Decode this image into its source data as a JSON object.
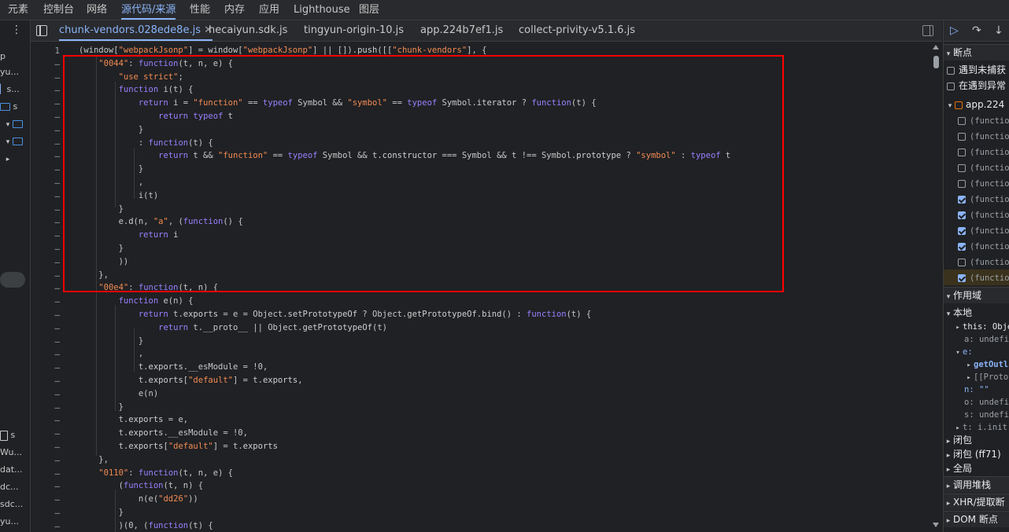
{
  "menu": [
    "元素",
    "控制台",
    "网络",
    "源代码/来源",
    "性能",
    "内存",
    "应用",
    "Lighthouse",
    "图层"
  ],
  "left_sidebar": {
    "rows": [
      "p",
      "yu...",
      "s...",
      "s",
      "",
      "",
      "",
      "s",
      "Wu...",
      "dat...",
      "dc...",
      "sdc...",
      "yu..."
    ]
  },
  "tabs": [
    "chunk-vendors.028ede8e.js",
    "hecaiyun.sdk.js",
    "tingyun-origin-10.js",
    "app.224b7ef1.js",
    "collect-privity-v5.1.6.js"
  ],
  "gutter": {
    "first": "1",
    "marker": "–"
  },
  "code": [
    "(window[\"webpackJsonp\"] = window[\"webpackJsonp\"] || []).push([[\"chunk-vendors\"], {",
    "    \"0044\": function(t, n, e) {",
    "        \"use strict\";",
    "        function i(t) {",
    "            return i = \"function\" == typeof Symbol && \"symbol\" == typeof Symbol.iterator ? function(t) {",
    "                return typeof t",
    "            }",
    "            : function(t) {",
    "                return t && \"function\" == typeof Symbol && t.constructor === Symbol && t !== Symbol.prototype ? \"symbol\" : typeof t",
    "            }",
    "            ,",
    "            i(t)",
    "        }",
    "        e.d(n, \"a\", (function() {",
    "            return i",
    "        }",
    "        ))",
    "    },",
    "    \"00e4\": function(t, n) {",
    "        function e(n) {",
    "            return t.exports = e = Object.setPrototypeOf ? Object.getPrototypeOf.bind() : function(t) {",
    "                return t.__proto__ || Object.getPrototypeOf(t)",
    "            }",
    "            ,",
    "            t.exports.__esModule = !0,",
    "            t.exports[\"default\"] = t.exports,",
    "            e(n)",
    "        }",
    "        t.exports = e,",
    "        t.exports.__esModule = !0,",
    "        t.exports[\"default\"] = t.exports",
    "    },",
    "    \"0110\": function(t, n, e) {",
    "        (function(t, n) {",
    "            n(e(\"dd26\"))",
    "        }",
    "        )(0, (function(t) {"
  ],
  "right_panel": {
    "breakpoints_header": "断点",
    "pause_uncaught": "遇到未捕获",
    "pause_caught": "在遇到异常",
    "file": "app.224",
    "fn_label": "(functio",
    "fn_checked": [
      false,
      false,
      false,
      false,
      false,
      true,
      true,
      true,
      true,
      false,
      true
    ],
    "scope_header": "作用域",
    "local": "本地",
    "scope_this": "this: Obje",
    "scope_a": "a: undefin",
    "scope_e": "e:",
    "scope_getoutl": "getOutl",
    "scope_proto": "[[Protot",
    "scope_n": "n: \"\"",
    "scope_o": "o: undefin",
    "scope_s": "s: undefin",
    "scope_t": "t: i.init",
    "closure": "闭包",
    "closure2": "闭包 (ff71)",
    "global": "全局",
    "call_stack": "调用堆栈",
    "xhr": "XHR/提取断",
    "dom": "DOM 断点"
  }
}
